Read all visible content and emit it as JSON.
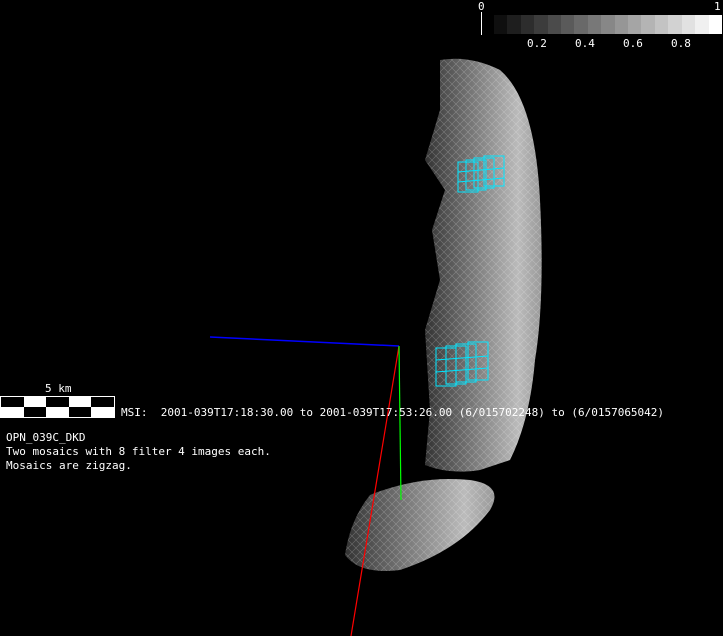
{
  "colorbar": {
    "min_label": "0",
    "max_label": "1",
    "tick_labels": [
      "0.2",
      "0.4",
      "0.6",
      "0.8"
    ],
    "steps": 17
  },
  "scalebar": {
    "label": "5 km"
  },
  "msi_line": "MSI:  2001-039T17:18:30.00 to 2001-039T17:53:26.00 (6/015702248) to (6/0157065042)",
  "info": {
    "title": "OPN_039C_DKD",
    "line1": "Two mosaics with 8 filter 4 images each.",
    "line2": "Mosaics are zigzag."
  },
  "colors": {
    "background": "#000000",
    "footprint": "#00e5ff",
    "axis_x": "#ff0000",
    "axis_y": "#00ff00",
    "axis_z": "#0000ff"
  }
}
